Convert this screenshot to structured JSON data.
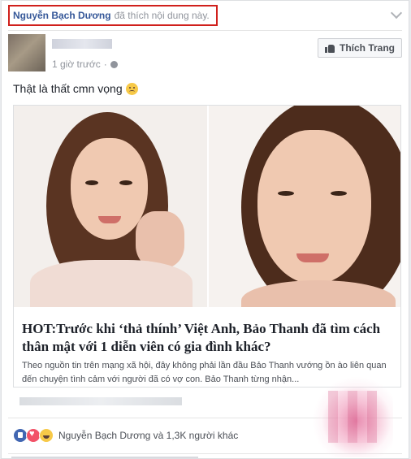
{
  "story": {
    "actor": "Nguyễn Bạch Dương",
    "action": "đã thích nội dung này."
  },
  "post": {
    "timestamp": "1 giờ trước",
    "like_page_label": "Thích Trang",
    "text": "Thật là thất cmn vọng"
  },
  "attachment": {
    "title": "HOT:Trước khi ‘thả thính’ Việt Anh, Bảo Thanh đã tìm cách thân mật với 1 diễn viên có gia đình khác?",
    "description": "Theo nguồn tin trên mạng xã hội, đây không phải lần đầu Bảo Thanh vướng ồn ào liên quan đến chuyện tình cảm với người đã có vợ con. Bảo Thanh từng nhận..."
  },
  "reactions": {
    "types": [
      "like-icon",
      "love-icon",
      "haha-icon"
    ],
    "summary": "Nguyễn Bạch Dương và 1,3K người khác"
  },
  "colors": {
    "highlight_border": "#d0201c",
    "link": "#365899",
    "like": "#4267b2",
    "love": "#f25268",
    "haha": "#f7c948"
  }
}
